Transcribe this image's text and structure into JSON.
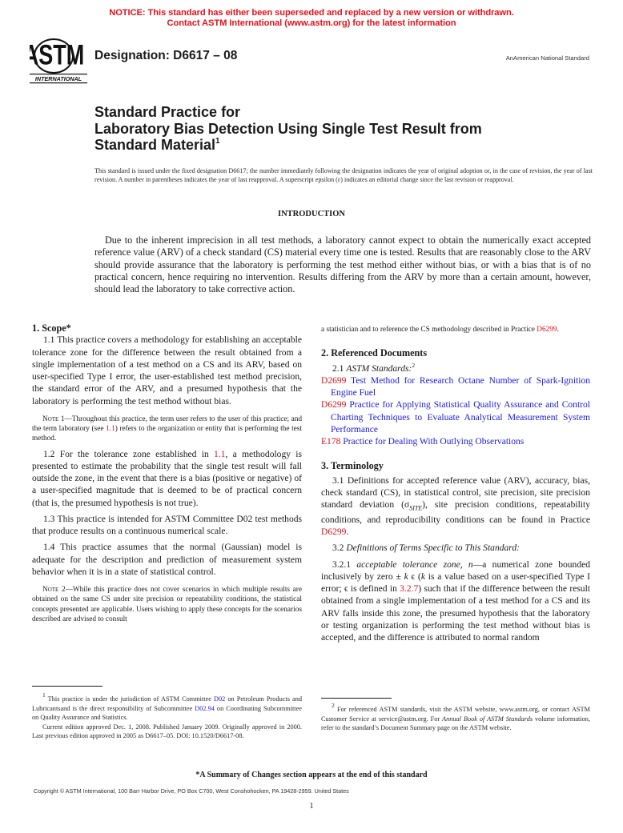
{
  "notice": {
    "line1": "NOTICE: This standard has either been superseded and replaced by a new version or withdrawn.",
    "line2": "Contact ASTM International (www.astm.org) for the latest information",
    "color": "#e8101b"
  },
  "header": {
    "logo_text": "ASTM",
    "logo_subtext": "INTERNATIONAL",
    "designation": "Designation: D6617 – 08",
    "national_standard": "AnAmerican National Standard"
  },
  "title": {
    "line1": "Standard Practice for",
    "line2": "Laboratory Bias Detection Using Single Test Result from",
    "line3": "Standard Material",
    "footnote_mark": "1"
  },
  "issued_note": "This standard is issued under the fixed designation D6617; the number immediately following the designation indicates the year of original adoption or, in the case of revision, the year of last revision. A number in parentheses indicates the year of last reapproval. A superscript epsilon (ε) indicates an editorial change since the last revision or reapproval.",
  "introduction": {
    "heading": "INTRODUCTION",
    "body": "Due to the inherent imprecision in all test methods, a laboratory cannot expect to obtain the numerically exact accepted reference value (ARV) of a check standard (CS) material every time one is tested. Results that are reasonably close to the ARV should provide assurance that the laboratory is performing the test method either without bias, or with a bias that is of no practical concern, hence requiring no intervention. Results differing from the ARV by more than a certain amount, however, should lead the laboratory to take corrective action."
  },
  "scope": {
    "heading": "1. Scope*",
    "p1_1": "1.1 This practice covers a methodology for establishing an acceptable tolerance zone for the difference between the result obtained from a single implementation of a test method on a CS and its ARV, based on user-specified Type I error, the user-established test method precision, the standard error of the ARV, and a presumed hypothesis that the laboratory is performing the test method without bias.",
    "note1_label": "Note",
    "note1_a": " 1—Throughout this practice, the term user refers to the user of this practice; and the term laboratory (see ",
    "note1_link": "1.1",
    "note1_b": ") refers to the organization or entity that is performing the test method.",
    "p1_2_a": "1.2 For the tolerance zone established in ",
    "p1_2_link": "1.1",
    "p1_2_b": ", a methodology is presented to estimate the probability that the single test result will fall outside the zone, in the event that there is a bias (positive or negative) of a user-specified magnitude that is deemed to be of practical concern (that is, the presumed hypothesis is not true).",
    "p1_3": "1.3 This practice is intended for ASTM Committee D02 test methods that produce results on a continuous numerical scale.",
    "p1_4": "1.4 This practice assumes that the normal (Gaussian) model is adequate for the description and prediction of measurement system behavior when it is in a state of statistical control.",
    "note2_label": "Note",
    "note2_text": " 2—While this practice does not cover scenarios in which multiple results are obtained on the same CS under site precision or repeatability conditions, the statistical concepts presented are applicable. Users wishing to apply these concepts for the scenarios described are advised to consult"
  },
  "right_col": {
    "continuation": "a statistician and to reference the CS methodology described in Practice ",
    "continuation_link": "D6299",
    "continuation_end": "."
  },
  "referenced_documents": {
    "heading": "2. Referenced Documents",
    "sub_label": "2.1 ",
    "sub_italic": "ASTM Standards:",
    "sub_footnote": "2",
    "items": [
      {
        "code": "D2699",
        "title": "Test Method for Research Octane Number of Spark-Ignition Engine Fuel"
      },
      {
        "code": "D6299",
        "title": "Practice for Applying Statistical Quality Assurance and Control Charting Techniques to Evaluate Analytical Measurement System Performance"
      },
      {
        "code": "E178",
        "title": "Practice for Dealing With Outlying Observations"
      }
    ]
  },
  "terminology": {
    "heading": "3. Terminology",
    "p3_1_a": "3.1 Definitions for accepted reference value (ARV), accuracy, bias, check standard (CS), in statistical control, site precision, site precision standard deviation (σ",
    "p3_1_sub": "SITE",
    "p3_1_b": "), site precision conditions, repeatability conditions, and reproducibility conditions can be found in Practice ",
    "p3_1_link": "D6299",
    "p3_1_end": ".",
    "p3_2_num": "3.2 ",
    "p3_2_italic": "Definitions of Terms Specific to This Standard:",
    "p3_2_1_num": "3.2.1 ",
    "p3_2_1_term": "acceptable tolerance zone, n",
    "p3_2_1_a": "—a numerical zone bounded inclusively by zero ± ",
    "p3_2_1_k": "k",
    "p3_2_1_b": " ϵ (",
    "p3_2_1_k2": "k",
    "p3_2_1_c": " is a value based on a user-specified Type I error; ϵ is defined in ",
    "p3_2_1_link": "3.2.7",
    "p3_2_1_d": ") such that if the difference between the result obtained from a single implementation of a test method for a CS and its ARV falls inside this zone, the presumed hypothesis that the laboratory or testing organization is performing the test method without bias is accepted, and the difference is attributed to normal random"
  },
  "footnotes": {
    "fn1_mark": "1",
    "fn1_a": " This practice is under the jurisdiction of ASTM Committee ",
    "fn1_link1": "D02",
    "fn1_b": " on Petroleum Products and Lubricantsand is the direct responsibility of Subcommittee ",
    "fn1_link2": "D02.94",
    "fn1_c": " on Coordinating Subcommittee on Quality Assurance and Statistics.",
    "fn1_p2": "Current edition approved Dec. 1, 2008. Published January 2009. Originally approved in 2000. Last previous edition approved in 2005 as D6617–05. DOI: 10.1520/D6617-08.",
    "fn2_mark": "2",
    "fn2_a": " For referenced ASTM standards, visit the ASTM website, www.astm.org, or contact ASTM Customer Service at service@astm.org. For ",
    "fn2_italic1": "Annual Book of ASTM Standards",
    "fn2_b": " volume information, refer to the standard’s Document Summary page on the ASTM website."
  },
  "footer": {
    "summary": "*A Summary of Changes section appears at the end of this standard",
    "copyright": "Copyright © ASTM International, 100 Barr Harbor Drive, PO Box C700, West Conshohocken, PA 19428-2959. United States",
    "page_number": "1"
  }
}
